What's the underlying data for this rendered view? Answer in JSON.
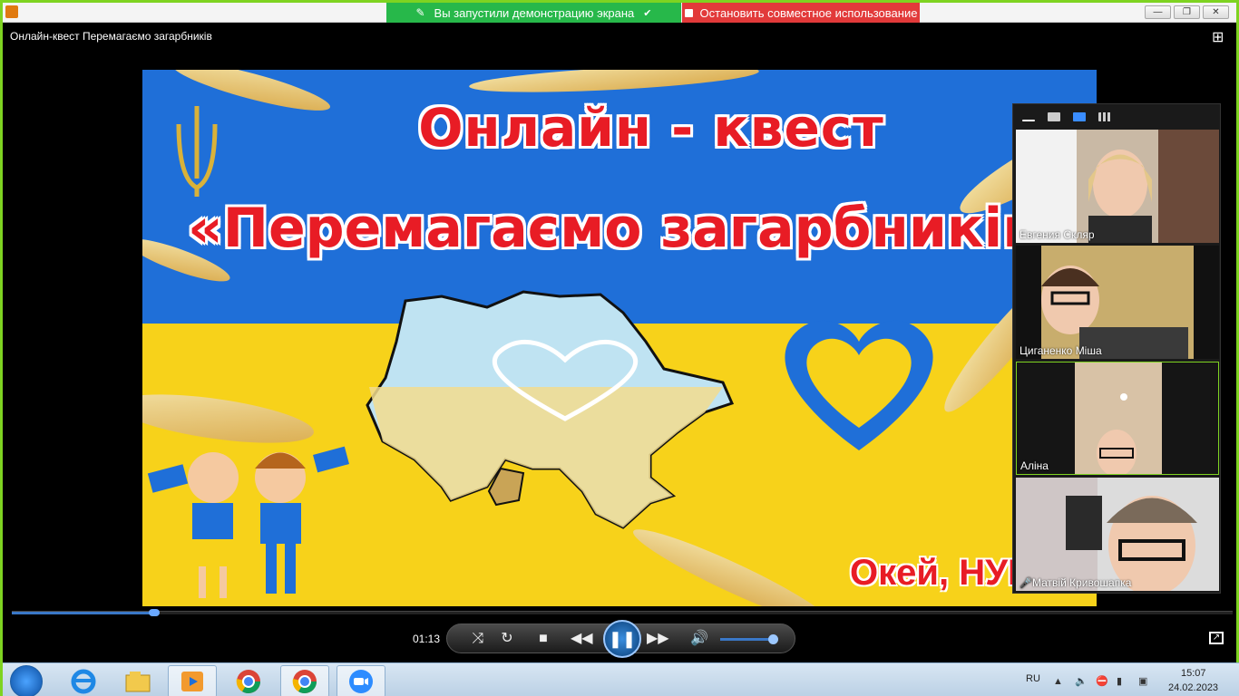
{
  "window": {
    "minimize_label": "—",
    "restore_label": "❐",
    "close_label": "✕"
  },
  "share_bar": {
    "status_text": "Вы запустили демонстрацию экрана",
    "stop_label": "Остановить совместное использование"
  },
  "video_title": "Онлайн-квест Перемагаємо загарбників",
  "slide": {
    "title_line1": "Онлайн  -  квест",
    "title_line2": "«Перемагаємо  загарбників»",
    "footer_text": "Окей, НУШ"
  },
  "participants": [
    {
      "name": "Евгения Скляр"
    },
    {
      "name": "Циганенко Міша"
    },
    {
      "name": "Аліна"
    },
    {
      "name": "Матвій Кривошапка",
      "muted": true
    }
  ],
  "player": {
    "time": "01:13",
    "progress_fraction": 0.117,
    "volume_fraction": 0.95
  },
  "taskbar": {
    "language": "RU",
    "clock_time": "15:07",
    "clock_date": "24.02.2023"
  },
  "colors": {
    "share_green": "#27b84a",
    "share_red": "#e23a3a",
    "frame_green": "#7ed321",
    "slide_blue": "#1f6fd8",
    "slide_yellow": "#f7d21a",
    "title_red": "#e81c25"
  }
}
